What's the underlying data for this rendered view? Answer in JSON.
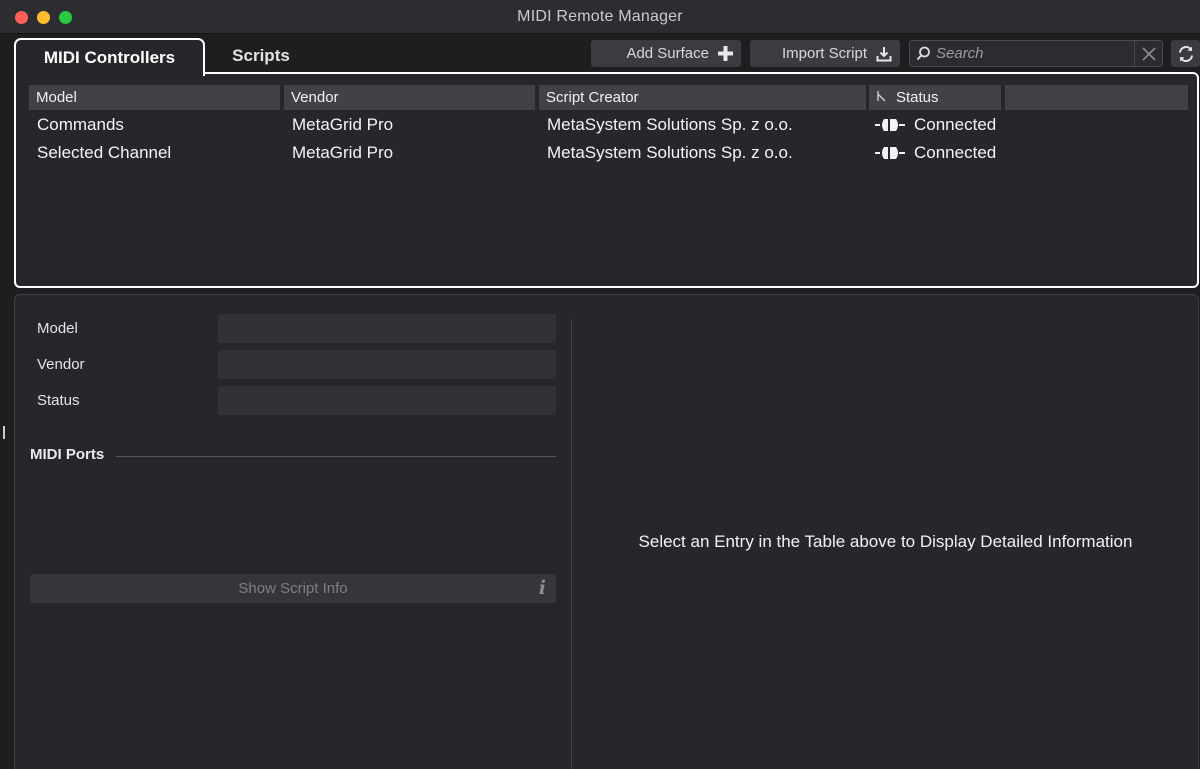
{
  "window": {
    "title": "MIDI Remote Manager"
  },
  "tabs": [
    {
      "label": "MIDI Controllers",
      "active": true
    },
    {
      "label": "Scripts",
      "active": false
    }
  ],
  "toolbar": {
    "add_surface_label": "Add Surface",
    "import_script_label": "Import Script",
    "search_placeholder": "Search",
    "search_value": ""
  },
  "table": {
    "columns": [
      "Model",
      "Vendor",
      "Script Creator",
      "Status",
      ""
    ],
    "rows": [
      {
        "model": "Commands",
        "vendor": "MetaGrid Pro",
        "creator": "MetaSystem Solutions Sp. z o.o.",
        "status": "Connected"
      },
      {
        "model": "Selected Channel",
        "vendor": "MetaGrid Pro",
        "creator": "MetaSystem Solutions Sp. z o.o.",
        "status": "Connected"
      }
    ]
  },
  "details": {
    "fields": [
      {
        "label": "Model",
        "value": ""
      },
      {
        "label": "Vendor",
        "value": ""
      },
      {
        "label": "Status",
        "value": ""
      }
    ],
    "midi_ports_label": "MIDI Ports",
    "show_script_info_label": "Show Script Info",
    "info_glyph": "i",
    "placeholder_message": "Select an Entry in the Table above to Display Detailed Information"
  },
  "colors": {
    "background": "#1c1e20",
    "panel": "#25272a",
    "header_cell": "#404245",
    "active_outline": "#ffffff",
    "close": "#ff5f57",
    "minimize": "#febc2e",
    "maximize": "#28c840"
  },
  "icons": [
    "plus-icon",
    "import-icon",
    "search-icon",
    "clear-icon",
    "refresh-icon",
    "sort-icon",
    "plug-connected-icon",
    "info-icon"
  ]
}
